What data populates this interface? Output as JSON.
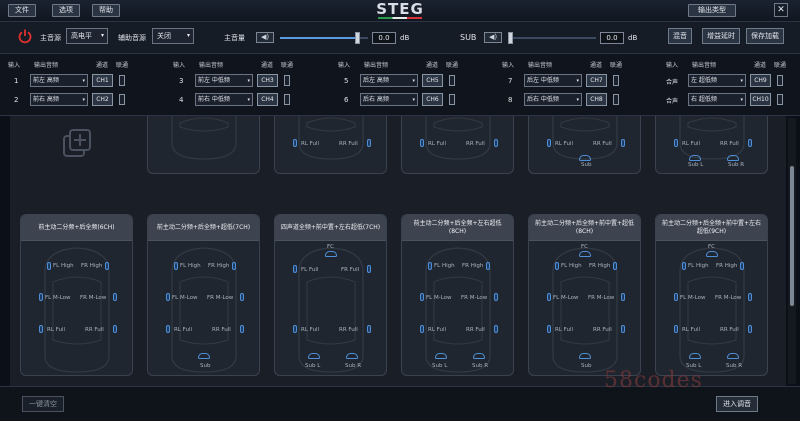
{
  "menu": {
    "file": "文件",
    "options": "选项",
    "help": "帮助"
  },
  "logo": "STEG",
  "output_type_label": "输出类型",
  "window": {
    "close": "✕"
  },
  "controls": {
    "main_source_label": "主音源",
    "main_source_value": "高电平",
    "aux_source_label": "辅助音源",
    "aux_source_value": "关闭",
    "master_label": "主音量",
    "master_value": "0.0",
    "master_unit": "dB",
    "master_level": 0.88,
    "sub_label": "SUB",
    "sub_value": "0.0",
    "sub_unit": "dB",
    "sub_level": 0.02,
    "mute_label": "混音",
    "gain_delay_label": "增益延时",
    "save_load_label": "保存加载"
  },
  "routing": {
    "header_input": "输入",
    "header_output": "输出音频",
    "header_channel": "通道",
    "header_link": "联通",
    "rows": [
      {
        "num": "1",
        "output": "前左 高频",
        "ch": "CH1"
      },
      {
        "num": "2",
        "output": "前右 高频",
        "ch": "CH2"
      },
      {
        "num": "3",
        "output": "前左 中低频",
        "ch": "CH3"
      },
      {
        "num": "4",
        "output": "前右 中低频",
        "ch": "CH4"
      },
      {
        "num": "5",
        "output": "后左 高频",
        "ch": "CH5"
      },
      {
        "num": "6",
        "output": "后右 高频",
        "ch": "CH6"
      },
      {
        "num": "7",
        "output": "后左 中低频",
        "ch": "CH7"
      },
      {
        "num": "8",
        "output": "后右 中低频",
        "ch": "CH8"
      },
      {
        "num": "合声",
        "output": "左 超低频",
        "ch": "CH9"
      },
      {
        "num": "合声",
        "output": "右 超低频",
        "ch": "CH10"
      }
    ]
  },
  "presets_top": [
    {
      "labels": [
        "RL Full",
        "RR Full"
      ]
    },
    {
      "labels": [
        "RL Full",
        "RR Full"
      ]
    },
    {
      "labels": [
        "RL Full",
        "RR Full",
        "Sub"
      ]
    },
    {
      "labels": [
        "RL Full",
        "RR Full",
        "Sub L",
        "Sub R"
      ]
    }
  ],
  "presets": [
    {
      "title": "前主动二分频+后全频(6CH)",
      "labels": {
        "fl_high": "FL High",
        "fr_high": "FR High",
        "fl_mlow": "FL M-Low",
        "fr_mlow": "FR M-Low",
        "rl": "RL Full",
        "rr": "RR Full"
      }
    },
    {
      "title": "前主动二分频+后全频+超低(7CH)",
      "labels": {
        "fl_high": "FL High",
        "fr_high": "FR High",
        "fl_mlow": "FL M-Low",
        "fr_mlow": "FR M-Low",
        "rl": "RL Full",
        "rr": "RR Full",
        "sub": "Sub"
      }
    },
    {
      "title": "四声道全频+前中置+左右超低(7CH)",
      "labels": {
        "fc": "FC",
        "fl": "FL Full",
        "fr": "FR Full",
        "rl": "RL Full",
        "rr": "RR Full",
        "subl": "Sub L",
        "subr": "Sub R"
      }
    },
    {
      "title": "前主动二分频+后全频+左右超低(8CH)",
      "labels": {
        "fl_high": "FL High",
        "fr_high": "FR High",
        "fl_mlow": "FL M-Low",
        "fr_mlow": "FR M-Low",
        "rl": "RL Full",
        "rr": "RR Full",
        "subl": "Sub L",
        "subr": "Sub R"
      }
    },
    {
      "title": "前主动二分频+后全频+前中置+超低(8CH)",
      "labels": {
        "fc": "FC",
        "fl_high": "FL High",
        "fr_high": "FR High",
        "fl_mlow": "FL M-Low",
        "fr_mlow": "FR M-Low",
        "rl": "RL Full",
        "rr": "RR Full",
        "sub": "Sub"
      }
    },
    {
      "title": "前主动二分频+后全频+前中置+左右超低(9CH)",
      "labels": {
        "fc": "FC",
        "fl_high": "FL High",
        "fr_high": "FR High",
        "fl_mlow": "FL M-Low",
        "fr_mlow": "FR M-Low",
        "rl": "RL Full",
        "rr": "RR Full",
        "subl": "Sub L",
        "subr": "Sub R"
      }
    }
  ],
  "bottom": {
    "reset_label": "一键清空",
    "enter_tuning_label": "进入调音"
  },
  "watermark": "58codes",
  "colors": {
    "accent": "#5a9ae0",
    "power": "#e0322e"
  }
}
